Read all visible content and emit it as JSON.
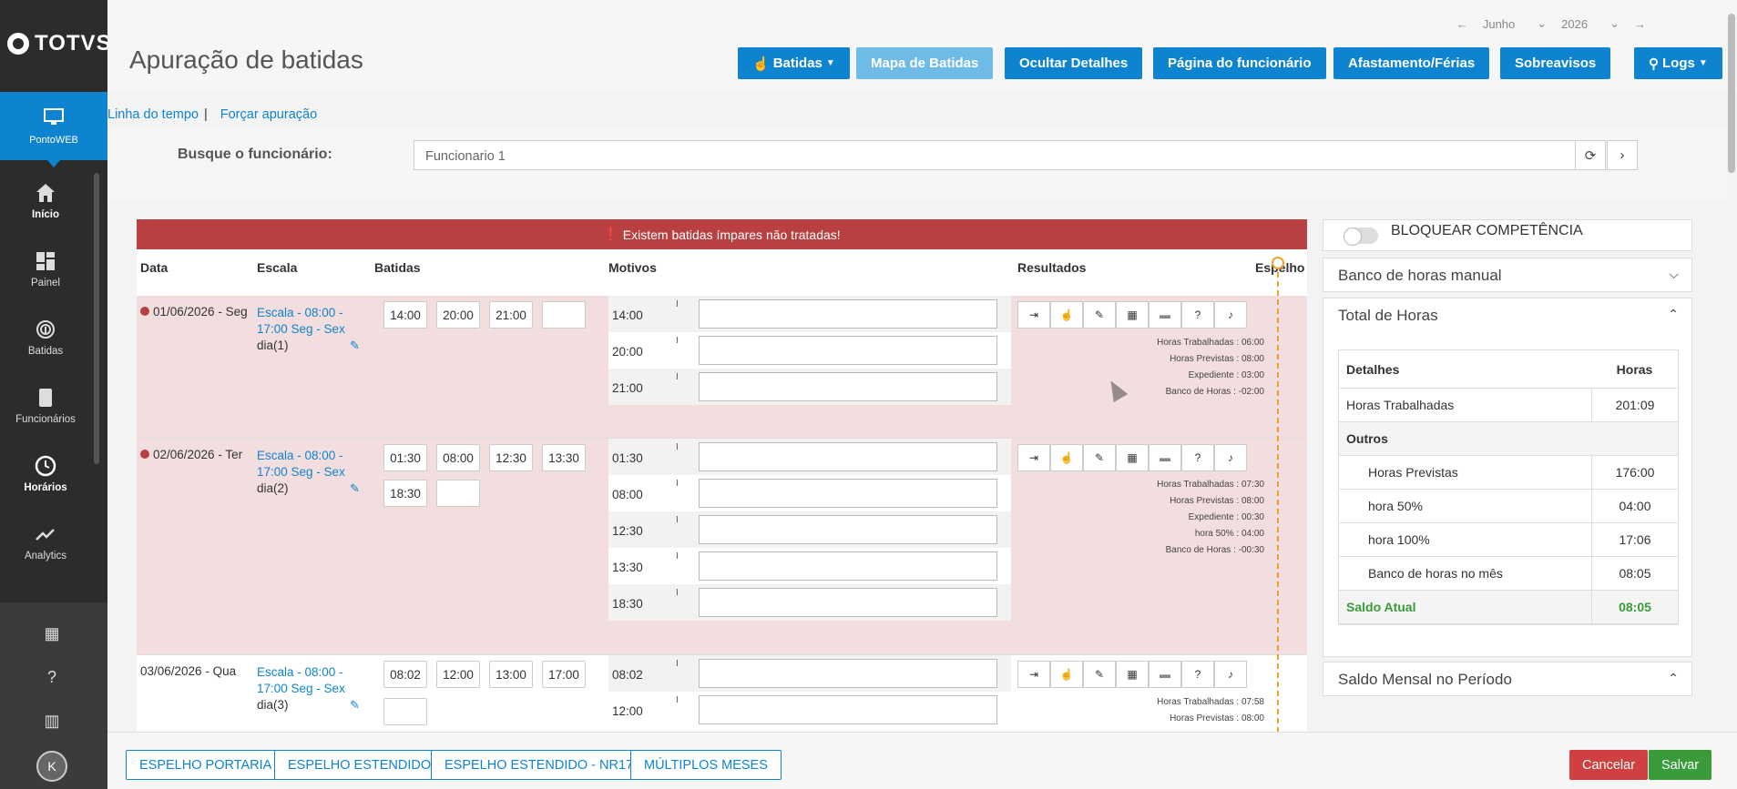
{
  "sidebar": {
    "brand": "TOTVS",
    "active": "PontoWEB",
    "items": [
      "Início",
      "Painel",
      "Batidas",
      "Funcionários",
      "Horários",
      "Analytics"
    ],
    "avatar": "K"
  },
  "header": {
    "title": "Apuração de batidas",
    "month": "Junho",
    "year": "2026",
    "buttons": {
      "batidas": "Batidas",
      "mapa": "Mapa de Batidas",
      "ocultar": "Ocultar Detalhes",
      "pagina": "Página do funcionário",
      "afast": "Afastamento/Férias",
      "sobre": "Sobreavisos",
      "logs": "Logs"
    }
  },
  "links": {
    "linha": "Linha do tempo",
    "sep": "|",
    "forcar": "Forçar apuração"
  },
  "search": {
    "label": "Busque o funcionário:",
    "value": "Funcionario 1"
  },
  "alert": "Existem batidas ímpares não tratadas!",
  "columns": {
    "data": "Data",
    "escala": "Escala",
    "batidas": "Batidas",
    "motivos": "Motivos",
    "resultados": "Resultados",
    "espelho": "Espelho"
  },
  "rows": [
    {
      "date": "01/06/2026 - Seg",
      "escala": "Escala - 08:00 - 17:00 Seg - Sex",
      "dia": "dia(1)",
      "batidas": [
        "14:00",
        "20:00",
        "21:00",
        ""
      ],
      "motivos": [
        "14:00",
        "20:00",
        "21:00"
      ],
      "resultados": [
        "Horas Trabalhadas : 06:00",
        "Horas Previstas : 08:00",
        "Expediente : 03:00",
        "Banco de Horas : -02:00"
      ]
    },
    {
      "date": "02/06/2026 - Ter",
      "escala": "Escala - 08:00 - 17:00 Seg - Sex",
      "dia": "dia(2)",
      "batidas": [
        "01:30",
        "08:00",
        "12:30",
        "13:30",
        "18:30",
        ""
      ],
      "motivos": [
        "01:30",
        "08:00",
        "12:30",
        "13:30",
        "18:30"
      ],
      "resultados": [
        "Horas Trabalhadas : 07:30",
        "Horas Previstas : 08:00",
        "Expediente : 00:30",
        "hora 50% : 04:00",
        "Banco de Horas : -00:30"
      ]
    },
    {
      "date": "03/06/2026 - Qua",
      "escala": "Escala - 08:00 - 17:00 Seg - Sex",
      "dia": "dia(3)",
      "batidas": [
        "08:02",
        "12:00",
        "13:00",
        "17:00",
        ""
      ],
      "motivos": [
        "08:02",
        "12:00"
      ],
      "resultados": [
        "Horas Trabalhadas : 07:58",
        "Horas Previstas : 08:00"
      ]
    }
  ],
  "right": {
    "bloquear": "BLOQUEAR COMPETÊNCIA",
    "banco": "Banco de horas manual",
    "total": "Total de Horas",
    "saldo_mensal": "Saldo Mensal no Período",
    "table": {
      "h1": "Detalhes",
      "h2": "Horas",
      "r1": [
        "Horas Trabalhadas",
        "201:09"
      ],
      "outros": "Outros",
      "r2": [
        "Horas Previstas",
        "176:00"
      ],
      "r3": [
        "hora 50%",
        "04:00"
      ],
      "r4": [
        "hora 100%",
        "17:06"
      ],
      "r5": [
        "Banco de horas no mês",
        "08:05"
      ],
      "saldo": [
        "Saldo Atual",
        "08:05"
      ]
    }
  },
  "footer": {
    "b1": "ESPELHO PORTARIA",
    "b2": "ESPELHO ESTENDIDO",
    "b3": "ESPELHO ESTENDIDO - NR17",
    "b4": "MÚLTIPLOS MESES",
    "cancel": "Cancelar",
    "save": "Salvar"
  },
  "colors": {
    "primary": "#0e84d0",
    "danger": "#b94040",
    "success": "#3a9b3a",
    "row_error": "#f2dede",
    "espelho": "#f0a030"
  }
}
